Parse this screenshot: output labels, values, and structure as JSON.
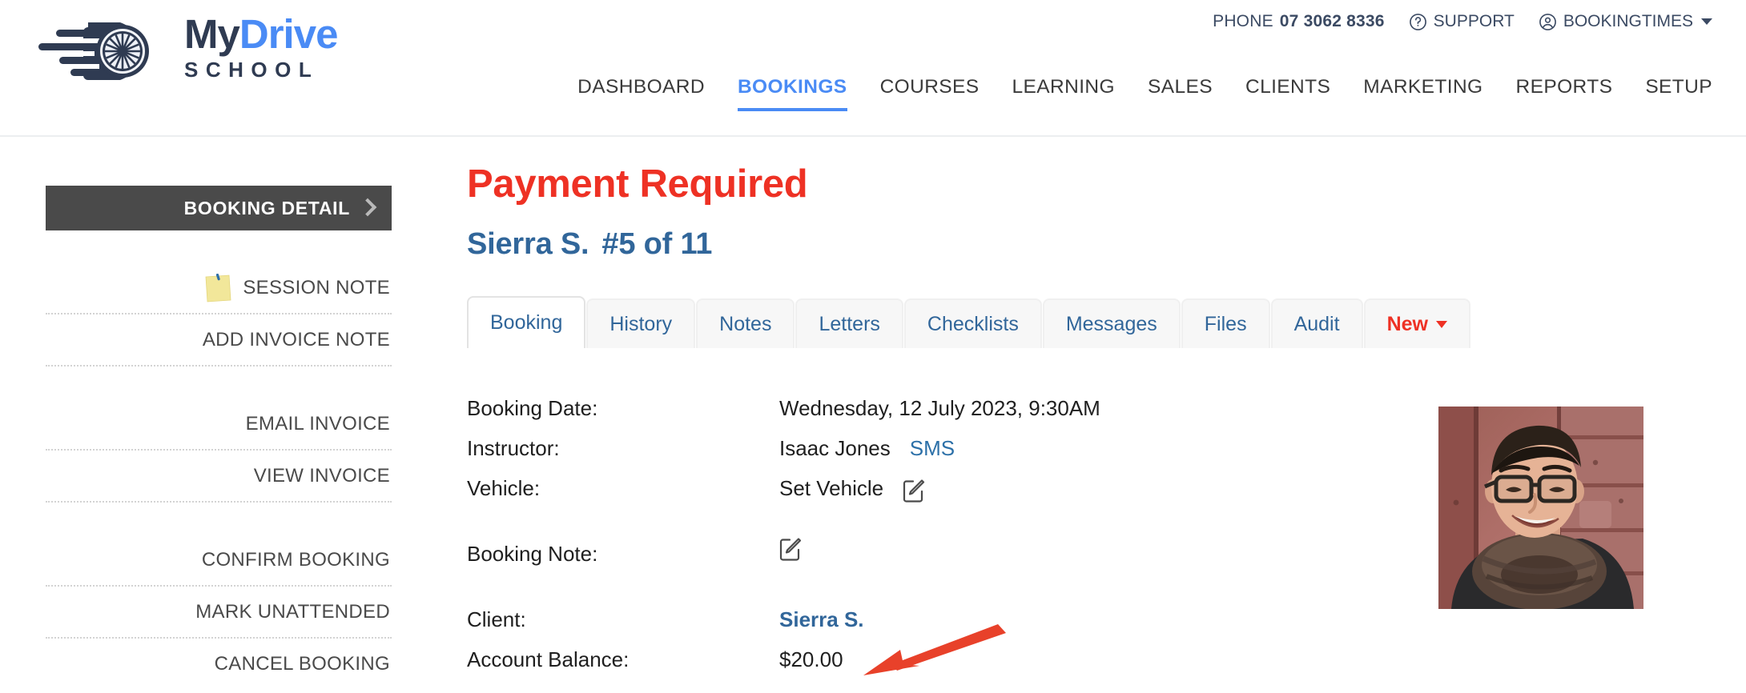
{
  "brand": {
    "name_part1": "My",
    "name_part2": "Drive",
    "name_part3": "SCHOOL",
    "blue": "#4a8bf5",
    "navy": "#2f3b52"
  },
  "header": {
    "utility": {
      "phone_label": "PHONE",
      "phone_number": "07 3062 8336",
      "support_label": "SUPPORT",
      "account_label": "BOOKINGTIMES"
    },
    "nav": [
      {
        "label": "DASHBOARD",
        "active": false
      },
      {
        "label": "BOOKINGS",
        "active": true
      },
      {
        "label": "COURSES",
        "active": false
      },
      {
        "label": "LEARNING",
        "active": false
      },
      {
        "label": "SALES",
        "active": false
      },
      {
        "label": "CLIENTS",
        "active": false
      },
      {
        "label": "MARKETING",
        "active": false
      },
      {
        "label": "REPORTS",
        "active": false
      },
      {
        "label": "SETUP",
        "active": false
      }
    ]
  },
  "sidebar": {
    "header_label": "BOOKING DETAIL",
    "items": [
      {
        "label": "SESSION NOTE",
        "icon": "sticky-note-icon"
      },
      {
        "label": "ADD INVOICE NOTE",
        "icon": ""
      },
      {
        "label": "EMAIL INVOICE",
        "icon": ""
      },
      {
        "label": "VIEW INVOICE",
        "icon": ""
      },
      {
        "label": "CONFIRM BOOKING",
        "icon": ""
      },
      {
        "label": "MARK UNATTENDED",
        "icon": ""
      },
      {
        "label": "CANCEL BOOKING",
        "icon": ""
      }
    ]
  },
  "main": {
    "status_title": "Payment Required",
    "status_color": "#ee3124",
    "client_name": "Sierra S.",
    "lesson_counter": "#5 of 11",
    "title_color": "#31669a",
    "tabs": [
      {
        "label": "Booking",
        "active": true,
        "dropdown": false
      },
      {
        "label": "History",
        "active": false,
        "dropdown": false
      },
      {
        "label": "Notes",
        "active": false,
        "dropdown": false
      },
      {
        "label": "Letters",
        "active": false,
        "dropdown": false
      },
      {
        "label": "Checklists",
        "active": false,
        "dropdown": false
      },
      {
        "label": "Messages",
        "active": false,
        "dropdown": false
      },
      {
        "label": "Files",
        "active": false,
        "dropdown": false
      },
      {
        "label": "Audit",
        "active": false,
        "dropdown": false
      },
      {
        "label": "New",
        "active": false,
        "dropdown": true
      }
    ],
    "details": {
      "booking_date_label": "Booking Date:",
      "booking_date_value": "Wednesday, 12 July 2023, 9:30AM",
      "instructor_label": "Instructor:",
      "instructor_value": "Isaac Jones",
      "instructor_sms_link": "SMS",
      "vehicle_label": "Vehicle:",
      "vehicle_value": "Set Vehicle",
      "booking_note_label": "Booking Note:",
      "booking_note_value": "",
      "client_label": "Client:",
      "client_value": "Sierra S.",
      "account_balance_label": "Account Balance:",
      "account_balance_value": "$20.00"
    }
  },
  "annotation": {
    "type": "arrow",
    "color": "#e8412a",
    "points_to": "Account Balance value"
  },
  "photo": {
    "alt": "client-profile-photo"
  }
}
